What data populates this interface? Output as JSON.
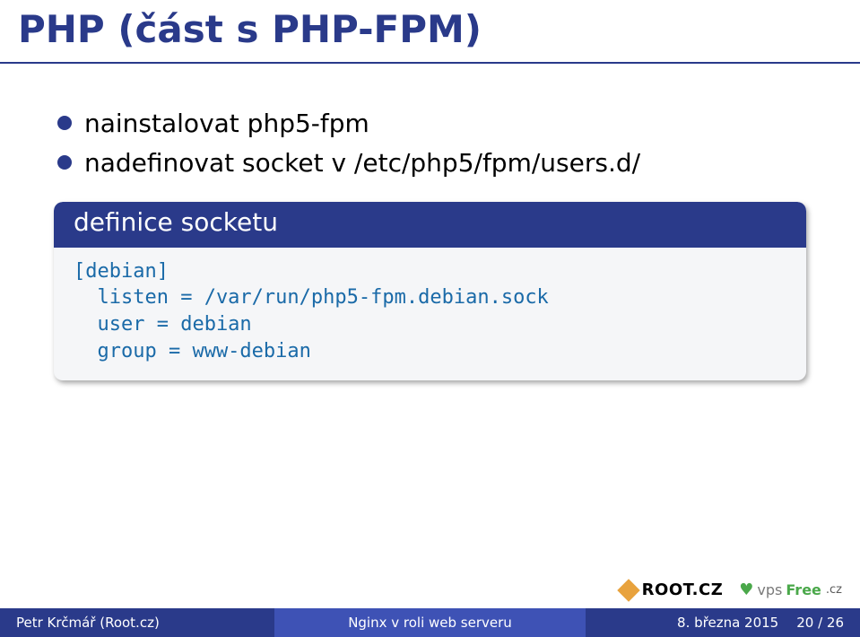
{
  "slide": {
    "title": "PHP (část s PHP-FPM)",
    "bullets": [
      "nainstalovat php5-fpm",
      "nadefinovat socket v /etc/php5/fpm/users.d/"
    ],
    "codeblock": {
      "header": "definice socketu",
      "body": "[debian]\n  listen = /var/run/php5-fpm.debian.sock\n  user = debian\n  group = www-debian"
    }
  },
  "logos": {
    "rootcz": "ROOT.CZ",
    "vpsfree_vps": "vps",
    "vpsfree_free": "Free",
    "vpsfree_cz": ".cz"
  },
  "footer": {
    "author": "Petr Krčmář (Root.cz)",
    "presentation_title": "Nginx v roli web serveru",
    "date": "8. března 2015",
    "page": "20 / 26"
  }
}
